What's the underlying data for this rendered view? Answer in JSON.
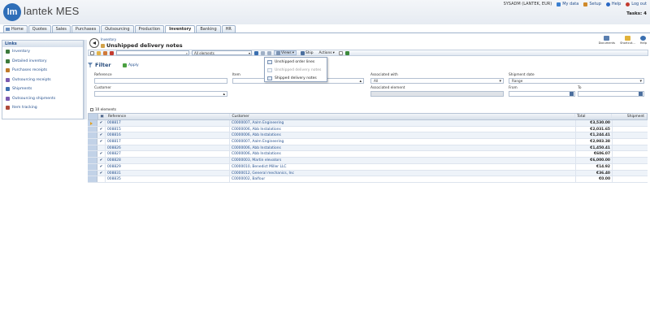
{
  "app": {
    "logo_short": "lm",
    "logo_text": "lantek MES"
  },
  "header": {
    "user": "SYSADM (LANTEK, EUR)",
    "links": [
      {
        "label": "My data",
        "icon": "user-icon",
        "color": "#3a7fd0"
      },
      {
        "label": "Setup",
        "icon": "gear-icon",
        "color": "#d08a2a"
      },
      {
        "label": "Help",
        "icon": "help-icon",
        "color": "#2a68c4"
      },
      {
        "label": "Log out",
        "icon": "logout-icon",
        "color": "#c33b2f"
      }
    ],
    "tasks": "Tasks: 4"
  },
  "tabs": [
    "Home",
    "Quotes",
    "Sales",
    "Purchases",
    "Outsourcing",
    "Production",
    "Inventory",
    "Banking",
    "HR"
  ],
  "active_tab": "Inventory",
  "links_panel": {
    "title": "Links",
    "items": [
      {
        "label": "Inventory",
        "color": "#3c7a3c"
      },
      {
        "label": "Detailed inventory",
        "color": "#3c7a3c"
      },
      {
        "label": "Purchases receipts",
        "color": "#c07a2a"
      },
      {
        "label": "Outsourcing receipts",
        "color": "#7a5ab0"
      },
      {
        "label": "Shipments",
        "color": "#3a6fb0"
      },
      {
        "label": "Outsourcing shipments",
        "color": "#7a5ab0"
      },
      {
        "label": "Item tracking",
        "color": "#b04a3a"
      }
    ]
  },
  "page": {
    "breadcrumb": "Inventory",
    "title": "Unshipped delivery notes"
  },
  "right_tools": [
    {
      "label": "Documents",
      "color": "#5a7fb0"
    },
    {
      "label": "Shortcut...",
      "color": "#e1b23a"
    },
    {
      "label": "Help",
      "color": "#3a6fb0"
    }
  ],
  "toolbar": {
    "search_placeholder": "",
    "element_filter": "All elements",
    "views_label": "Views",
    "ship_label": "Ship",
    "actions_label": "Actions"
  },
  "views_menu": [
    {
      "label": "Unshipped order lines",
      "disabled": false
    },
    {
      "label": "Unshipped delivery notes",
      "disabled": true
    },
    {
      "label": "Shipped delivery notes",
      "disabled": false
    }
  ],
  "filter": {
    "title": "Filter",
    "apply": "Apply",
    "reference_label": "Reference",
    "reference_value": "",
    "item_label": "Item",
    "item_value": "",
    "associated_with_label": "Associated with",
    "associated_with_value": "All",
    "shipment_date_label": "Shipment date",
    "shipment_date_value": "Range",
    "customer_label": "Customer",
    "customer_value": "",
    "associated_element_label": "Associated element",
    "associated_element_value": "",
    "from_label": "From",
    "from_value": "",
    "to_label": "To",
    "to_value": ""
  },
  "grid": {
    "count_label": "10 elements",
    "columns": {
      "reference": "Reference",
      "customer": "Customer",
      "total": "Total",
      "shipment": "Shipment"
    },
    "rows": [
      {
        "checked": true,
        "reference": "008817",
        "customer": "C0000007, Aalm Engineering",
        "total": "€3,530.00"
      },
      {
        "checked": true,
        "reference": "008815",
        "customer": "C0000006, Abb Instalations",
        "total": "€2,031.65"
      },
      {
        "checked": true,
        "reference": "008816",
        "customer": "C0000006, Abb Instalations",
        "total": "€1,244.41"
      },
      {
        "checked": true,
        "reference": "008817",
        "customer": "C0000007, Aalm Engineering",
        "total": "€2,983.38"
      },
      {
        "checked": false,
        "reference": "008826",
        "customer": "C0000006, Abb Instalations",
        "total": "€1,450.41"
      },
      {
        "checked": true,
        "reference": "008827",
        "customer": "C0000006, Abb Instalations",
        "total": "€606.07"
      },
      {
        "checked": true,
        "reference": "008828",
        "customer": "C0000003, Martin elevators",
        "total": "€6,000.00"
      },
      {
        "checked": true,
        "reference": "008829",
        "customer": "C0000010, Benedict Miller LLC",
        "total": "€14.92"
      },
      {
        "checked": true,
        "reference": "008831",
        "customer": "C0000012, General mechanics, Inc",
        "total": "€36.40"
      },
      {
        "checked": false,
        "reference": "008835",
        "customer": "C0000002, Balfour",
        "total": "€0.00"
      }
    ]
  }
}
